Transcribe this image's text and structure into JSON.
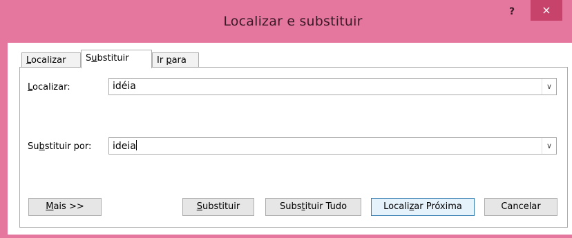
{
  "window": {
    "title": "Localizar e substituir",
    "help_label": "?",
    "close_label": "×"
  },
  "tabs": [
    {
      "pre": "",
      "key": "L",
      "post": "ocalizar",
      "active": false
    },
    {
      "pre": "S",
      "key": "u",
      "post": "bstituir",
      "active": true
    },
    {
      "pre": "Ir ",
      "key": "p",
      "post": "ara",
      "active": false
    }
  ],
  "find": {
    "label_pre": "",
    "label_key": "L",
    "label_post": "ocalizar:",
    "value": "idéia"
  },
  "replace": {
    "label_pre": "Su",
    "label_key": "b",
    "label_post": "stituir por:",
    "value": "ideia"
  },
  "buttons": {
    "more": {
      "pre": "",
      "key": "M",
      "post": "ais >>"
    },
    "replace": {
      "pre": "",
      "key": "S",
      "post": "ubstituir"
    },
    "replace_all": {
      "pre": "Subs",
      "key": "t",
      "post": "ituir Tudo"
    },
    "find_next": {
      "pre": "Locali",
      "key": "z",
      "post": "ar Próxima"
    },
    "cancel": {
      "label": "Cancelar"
    }
  },
  "icons": {
    "dropdown": "chevron-down-icon"
  }
}
